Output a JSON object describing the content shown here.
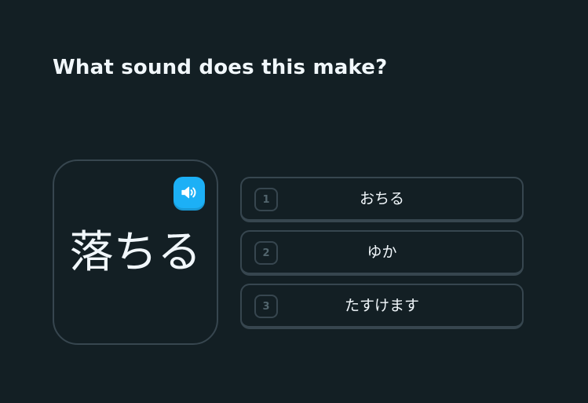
{
  "challenge": {
    "prompt": "What sound does this make?",
    "word": "落ちる",
    "audio_icon": "speaker-icon"
  },
  "options": [
    {
      "key": "1",
      "text": "おちる"
    },
    {
      "key": "2",
      "text": "ゆか"
    },
    {
      "key": "3",
      "text": "たすけます"
    }
  ],
  "colors": {
    "background": "#131f24",
    "border": "#37464f",
    "accent": "#1cb0f6",
    "text": "#f1f7fb",
    "key_text": "#52656d"
  }
}
